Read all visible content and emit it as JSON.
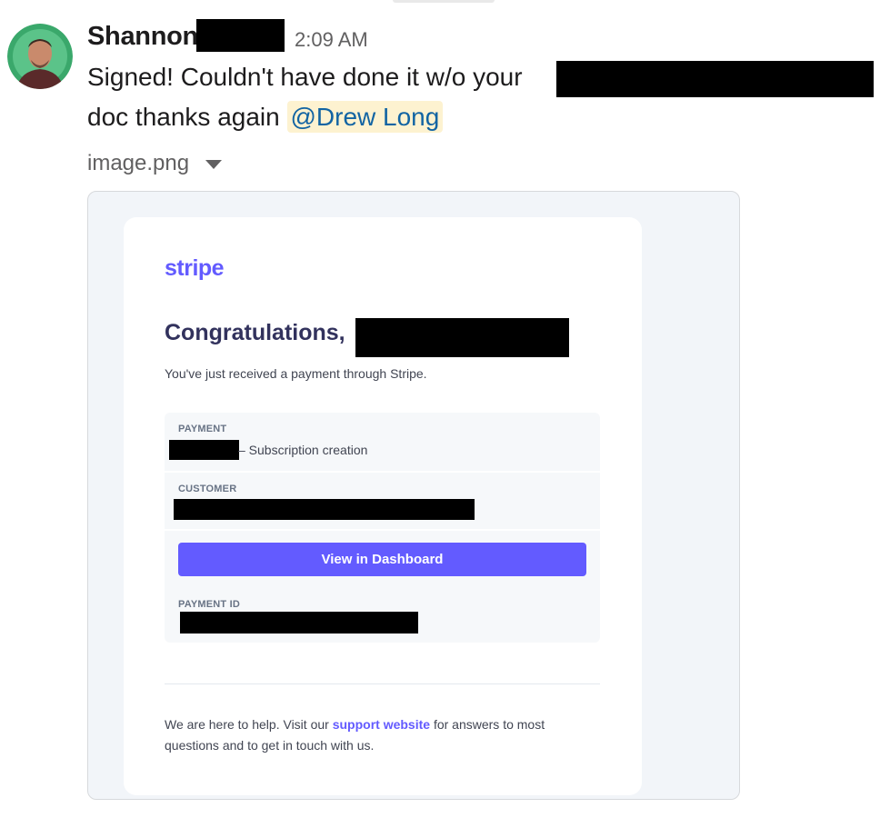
{
  "message": {
    "sender": "Shannon",
    "time": "2:09 AM",
    "line1": "Signed! Couldn't have done it w/o your",
    "line2_text": "doc thanks again",
    "mention": "@Drew Long"
  },
  "attachment": {
    "filename": "image.png"
  },
  "email": {
    "logo": "stripe",
    "heading": "Congratulations,",
    "intro": "You've just received a payment through Stripe.",
    "payment_label": "PAYMENT",
    "payment_value": "– Subscription creation",
    "customer_label": "CUSTOMER",
    "button_label": "View in Dashboard",
    "payment_id_label": "PAYMENT ID",
    "footer_before": "We are here to help. Visit our ",
    "footer_link": "support website",
    "footer_after": " for answers to most questions and to get in touch with us."
  },
  "colors": {
    "stripe_accent": "#635bff",
    "mention_bg": "#fdf2d0",
    "mention_text": "#1264a3"
  }
}
